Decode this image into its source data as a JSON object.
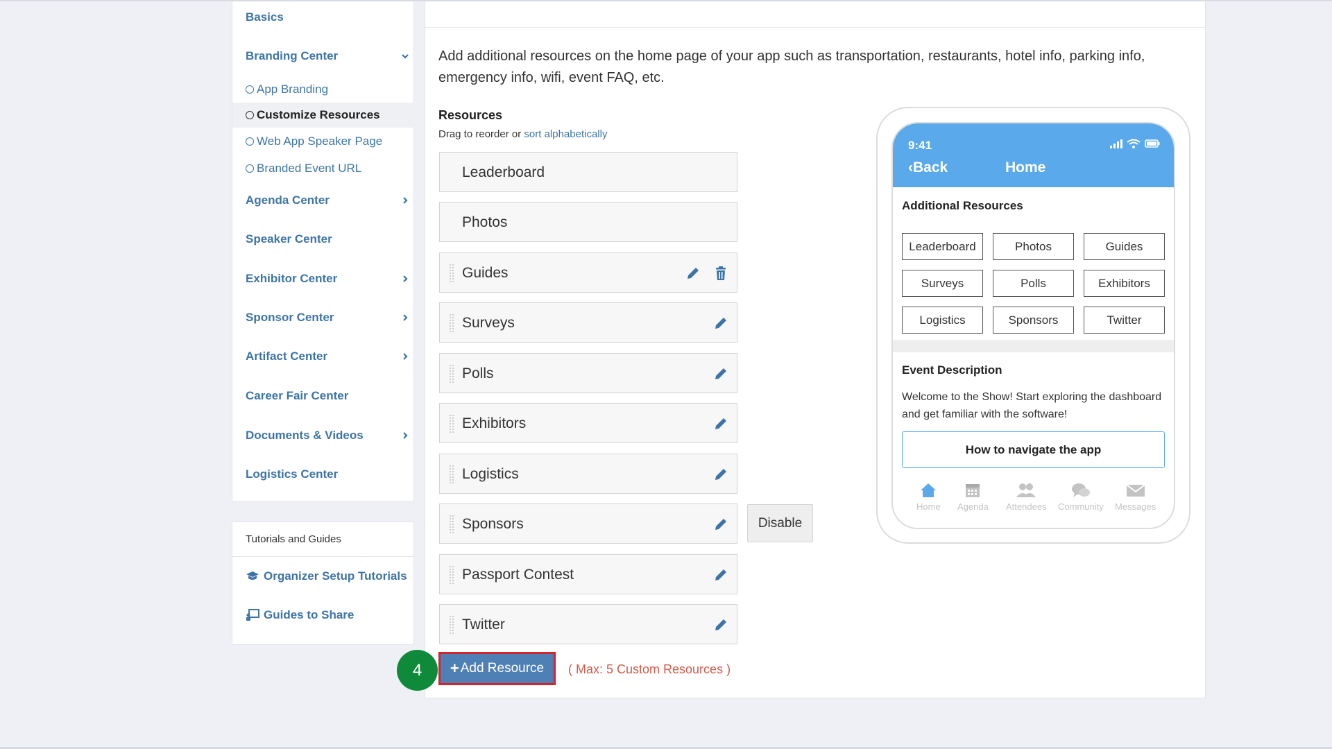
{
  "sidebar": {
    "basics": "Basics",
    "branding_center": "Branding Center",
    "branding_sub": [
      "App Branding",
      "Customize Resources",
      "Web App Speaker Page",
      "Branded Event URL"
    ],
    "agenda_center": "Agenda Center",
    "speaker_center": "Speaker Center",
    "exhibitor_center": "Exhibitor Center",
    "sponsor_center": "Sponsor Center",
    "artifact_center": "Artifact Center",
    "career_fair_center": "Career Fair Center",
    "documents_videos": "Documents & Videos",
    "logistics_center": "Logistics Center"
  },
  "tutorials": {
    "header": "Tutorials and Guides",
    "organizer_setup": "Organizer Setup Tutorials",
    "guides_to_share": "Guides to Share"
  },
  "main": {
    "description": "Add additional resources on the home page of your app such as transportation, restaurants, hotel info, parking info, emergency info, wifi, event FAQ, etc.",
    "resources_title": "Resources",
    "drag_text": "Drag to reorder or",
    "sort_link": "sort alphabetically",
    "resources": [
      "Leaderboard",
      "Photos",
      "Guides",
      "Surveys",
      "Polls",
      "Exhibitors",
      "Logistics",
      "Sponsors",
      "Passport Contest",
      "Twitter"
    ],
    "disable_label": "Disable",
    "add_resource_label": "Add Resource",
    "max_note": "( Max: 5 Custom Resources )",
    "step_number": "4"
  },
  "phone": {
    "time": "9:41",
    "back_label": "Back",
    "home_title": "Home",
    "additional_resources_title": "Additional Resources",
    "grid": [
      "Leaderboard",
      "Photos",
      "Guides",
      "Surveys",
      "Polls",
      "Exhibitors",
      "Logistics",
      "Sponsors",
      "Twitter"
    ],
    "event_description_title": "Event Description",
    "event_description_text": "Welcome to the Show! Start exploring the dashboard and get familiar with the software!",
    "navigate_button": "How to navigate the app",
    "tabs": [
      "Home",
      "Agenda",
      "Attendees",
      "Community",
      "Messages"
    ]
  },
  "colors": {
    "link_blue": "#3d74a8",
    "phone_blue": "#5aa9ea",
    "add_button": "#4e7fb5",
    "highlight_red": "#d1242f",
    "step_green": "#0e8a3a",
    "max_note": "#d45a4b"
  }
}
